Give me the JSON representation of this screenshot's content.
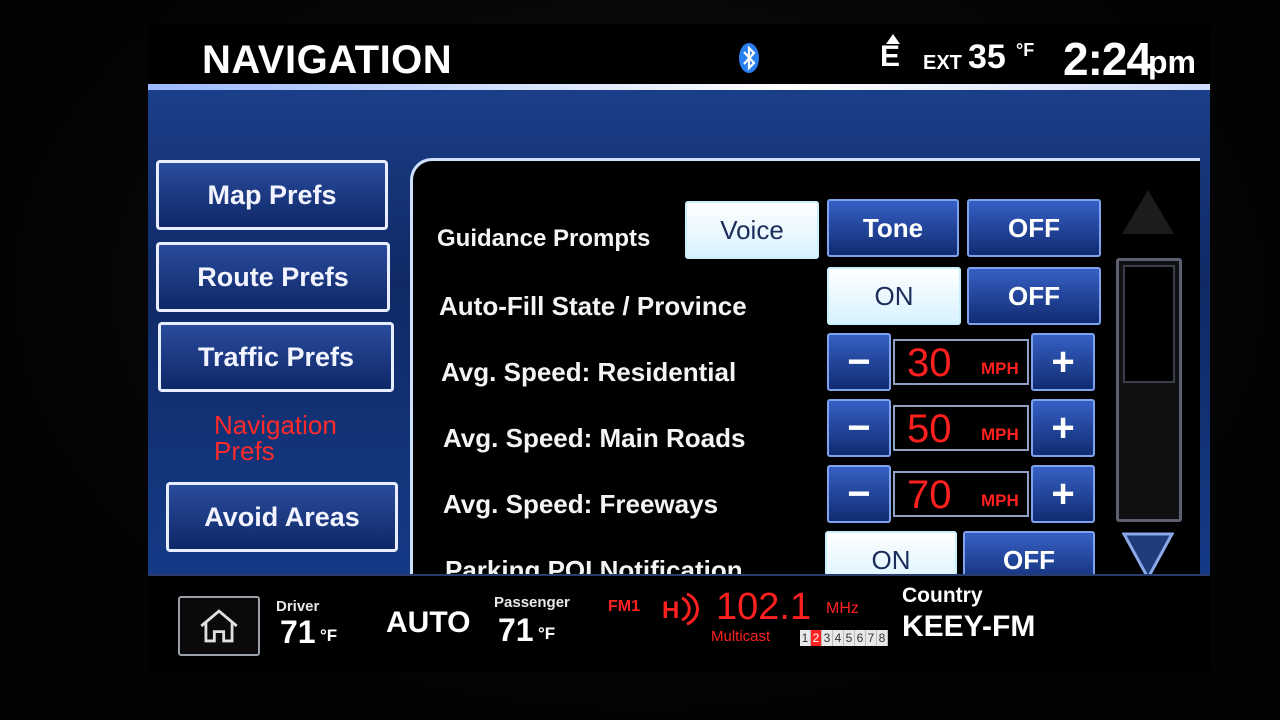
{
  "header": {
    "title": "NAVIGATION",
    "compass_direction": "E",
    "ext_label": "EXT",
    "ext_temp": "35",
    "ext_unit": "°F",
    "time": "2:24",
    "ampm": "pm"
  },
  "tabs": {
    "map_prefs": "Map Prefs",
    "route_prefs": "Route Prefs",
    "traffic_prefs": "Traffic Prefs",
    "navigation_prefs_line1": "Navigation",
    "navigation_prefs_line2": "Prefs",
    "avoid_areas": "Avoid Areas"
  },
  "settings": {
    "guidance": {
      "label": "Guidance Prompts",
      "options": [
        "Voice",
        "Tone",
        "OFF"
      ],
      "selected": "Voice"
    },
    "autofill": {
      "label": "Auto-Fill State / Province",
      "on": "ON",
      "off": "OFF",
      "selected": "ON"
    },
    "speed_residential": {
      "label": "Avg. Speed: Residential",
      "value": "30",
      "unit": "MPH"
    },
    "speed_main": {
      "label": "Avg. Speed: Main Roads",
      "value": "50",
      "unit": "MPH"
    },
    "speed_freeways": {
      "label": "Avg. Speed: Freeways",
      "value": "70",
      "unit": "MPH"
    },
    "parking": {
      "label": "Parking POI Notification",
      "on": "ON",
      "off": "OFF",
      "selected": "ON"
    },
    "minus": "−",
    "plus": "+"
  },
  "status": {
    "driver_label": "Driver",
    "driver_temp": "71",
    "passenger_label": "Passenger",
    "passenger_temp": "71",
    "temp_unit": "°F",
    "climate_mode": "AUTO",
    "band": "FM1",
    "frequency": "102.1",
    "freq_unit": "MHz",
    "multicast_label": "Multicast",
    "multicast_channels": [
      "1",
      "2",
      "3",
      "4",
      "5",
      "6",
      "7",
      "8"
    ],
    "multicast_active": "2",
    "genre": "Country",
    "station": "KEEY-FM"
  },
  "colors": {
    "accent_blue": "#1b3f8a",
    "active_red": "#ff2020",
    "selected_button": "#d8f2ff"
  }
}
